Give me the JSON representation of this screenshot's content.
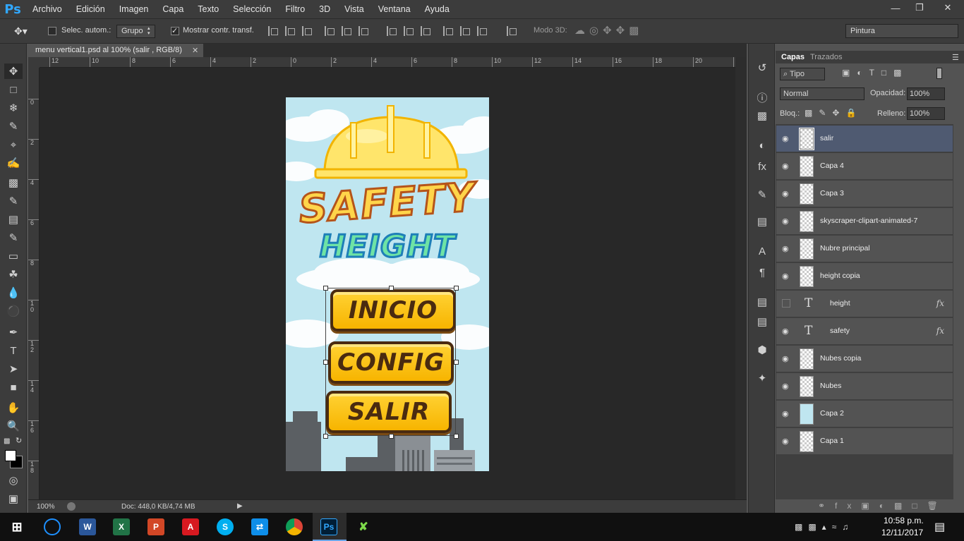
{
  "app": {
    "logo": "Ps",
    "menu": [
      "Archivo",
      "Edición",
      "Imagen",
      "Capa",
      "Texto",
      "Selección",
      "Filtro",
      "3D",
      "Vista",
      "Ventana",
      "Ayuda"
    ],
    "window_controls": [
      "—",
      "❐",
      "✕"
    ]
  },
  "options": {
    "auto_select_label": "Selec. autom.:",
    "auto_select_checked": false,
    "group_value": "Grupo",
    "show_transform_label": "Mostrar contr. transf.",
    "show_transform_checked": true,
    "mode3d_label": "Modo 3D:",
    "workspace": "Pintura"
  },
  "document": {
    "tab_title": "menu vertical1.psd al 100% (salir , RGB/8)",
    "zoom": "100%",
    "doc_info": "Doc: 448,0 KB/4,74 MB"
  },
  "rulers": {
    "h_labels": [
      "12",
      "10",
      "8",
      "6",
      "4",
      "2",
      "0",
      "2",
      "4",
      "6",
      "8",
      "10",
      "12",
      "14",
      "16",
      "18",
      "20",
      "22"
    ],
    "v_labels": [
      "0",
      "2",
      "4",
      "6",
      "8",
      "1\n0",
      "1\n2",
      "1\n4",
      "1\n6",
      "1\n8"
    ]
  },
  "artwork": {
    "title_line1": "SAFETY",
    "title_line2": "HEIGHT",
    "buttons": [
      "INICIO",
      "CONFIG",
      "SALIR"
    ]
  },
  "layers_panel": {
    "tabs": [
      "Capas",
      "Trazados"
    ],
    "filter_kind": "Tipo",
    "blend_mode": "Normal",
    "opacity_label": "Opacidad:",
    "opacity_value": "100%",
    "lock_label": "Bloq.:",
    "fill_label": "Relleno:",
    "fill_value": "100%",
    "layers": [
      {
        "name": "salir",
        "visible": true,
        "type": "pixel",
        "selected": true
      },
      {
        "name": "Capa 4",
        "visible": true,
        "type": "pixel"
      },
      {
        "name": "Capa 3",
        "visible": true,
        "type": "pixel"
      },
      {
        "name": "skyscraper-clipart-animated-7",
        "visible": true,
        "type": "pixel"
      },
      {
        "name": "Nubre principal",
        "visible": true,
        "type": "pixel"
      },
      {
        "name": "height copia",
        "visible": true,
        "type": "pixel"
      },
      {
        "name": "height",
        "visible": false,
        "type": "text",
        "fx": "fx"
      },
      {
        "name": "safety",
        "visible": true,
        "type": "text",
        "fx": "fx"
      },
      {
        "name": "Nubes copia",
        "visible": true,
        "type": "pixel"
      },
      {
        "name": "Nubes",
        "visible": true,
        "type": "pixel"
      },
      {
        "name": "Capa 2",
        "visible": true,
        "type": "fill"
      },
      {
        "name": "Capa 1",
        "visible": true,
        "type": "pixel"
      }
    ]
  },
  "taskbar": {
    "time": "10:58 p.m.",
    "date": "12/11/2017"
  },
  "colors": {
    "ps_blue": "#31a8ff",
    "selected_layer": "#4f5a71",
    "button_yellow": "#ffc61a",
    "title_teal": "#3cc7d8"
  }
}
